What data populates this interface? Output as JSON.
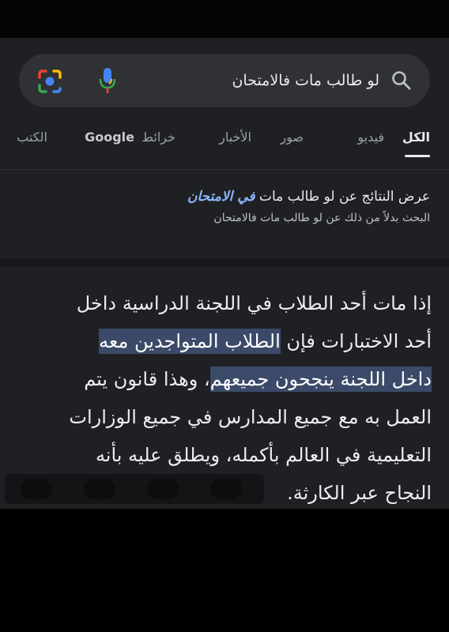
{
  "search": {
    "query": "لو طالب مات فالامتحان"
  },
  "tabs": [
    {
      "label": "الكل",
      "active": true
    },
    {
      "label": "فيديو"
    },
    {
      "label": "صور"
    },
    {
      "label": "الأخبار"
    },
    {
      "label": "خرائط"
    },
    {
      "label": "Google"
    },
    {
      "label": "الكتب"
    }
  ],
  "correction": {
    "prefix": "عرض النتائج عن لو طالب مات ",
    "corrected": "في الامتحان",
    "alt_line": "البحث بدلاً من ذلك عن لو طالب مات فالامتحان"
  },
  "snippet": {
    "lines": [
      {
        "before": "إذا مات أحد الطلاب في اللجنة الدراسية داخل",
        "hl": "",
        "after": ""
      },
      {
        "before": "أحد الاختبارات فإن ",
        "hl": "الطلاب المتواجدين معه",
        "after": ""
      },
      {
        "before": "",
        "hl": "داخل اللجنة ينجحون جميعهم",
        "after": "، وهذا قانون يتم"
      },
      {
        "before": "العمل به مع جميع المدارس في جميع الوزارات",
        "hl": "",
        "after": ""
      },
      {
        "before": "التعليمية في العالم بأكمله، ويطلق عليه بأنه",
        "hl": "",
        "after": ""
      },
      {
        "before": "النجاح عبر الكارثة.",
        "hl": "",
        "after": ""
      }
    ]
  },
  "colors": {
    "background": "#1f2023",
    "search_bar": "#303134",
    "highlight": "#3b4a68",
    "link_blue": "#8ab4f8"
  }
}
